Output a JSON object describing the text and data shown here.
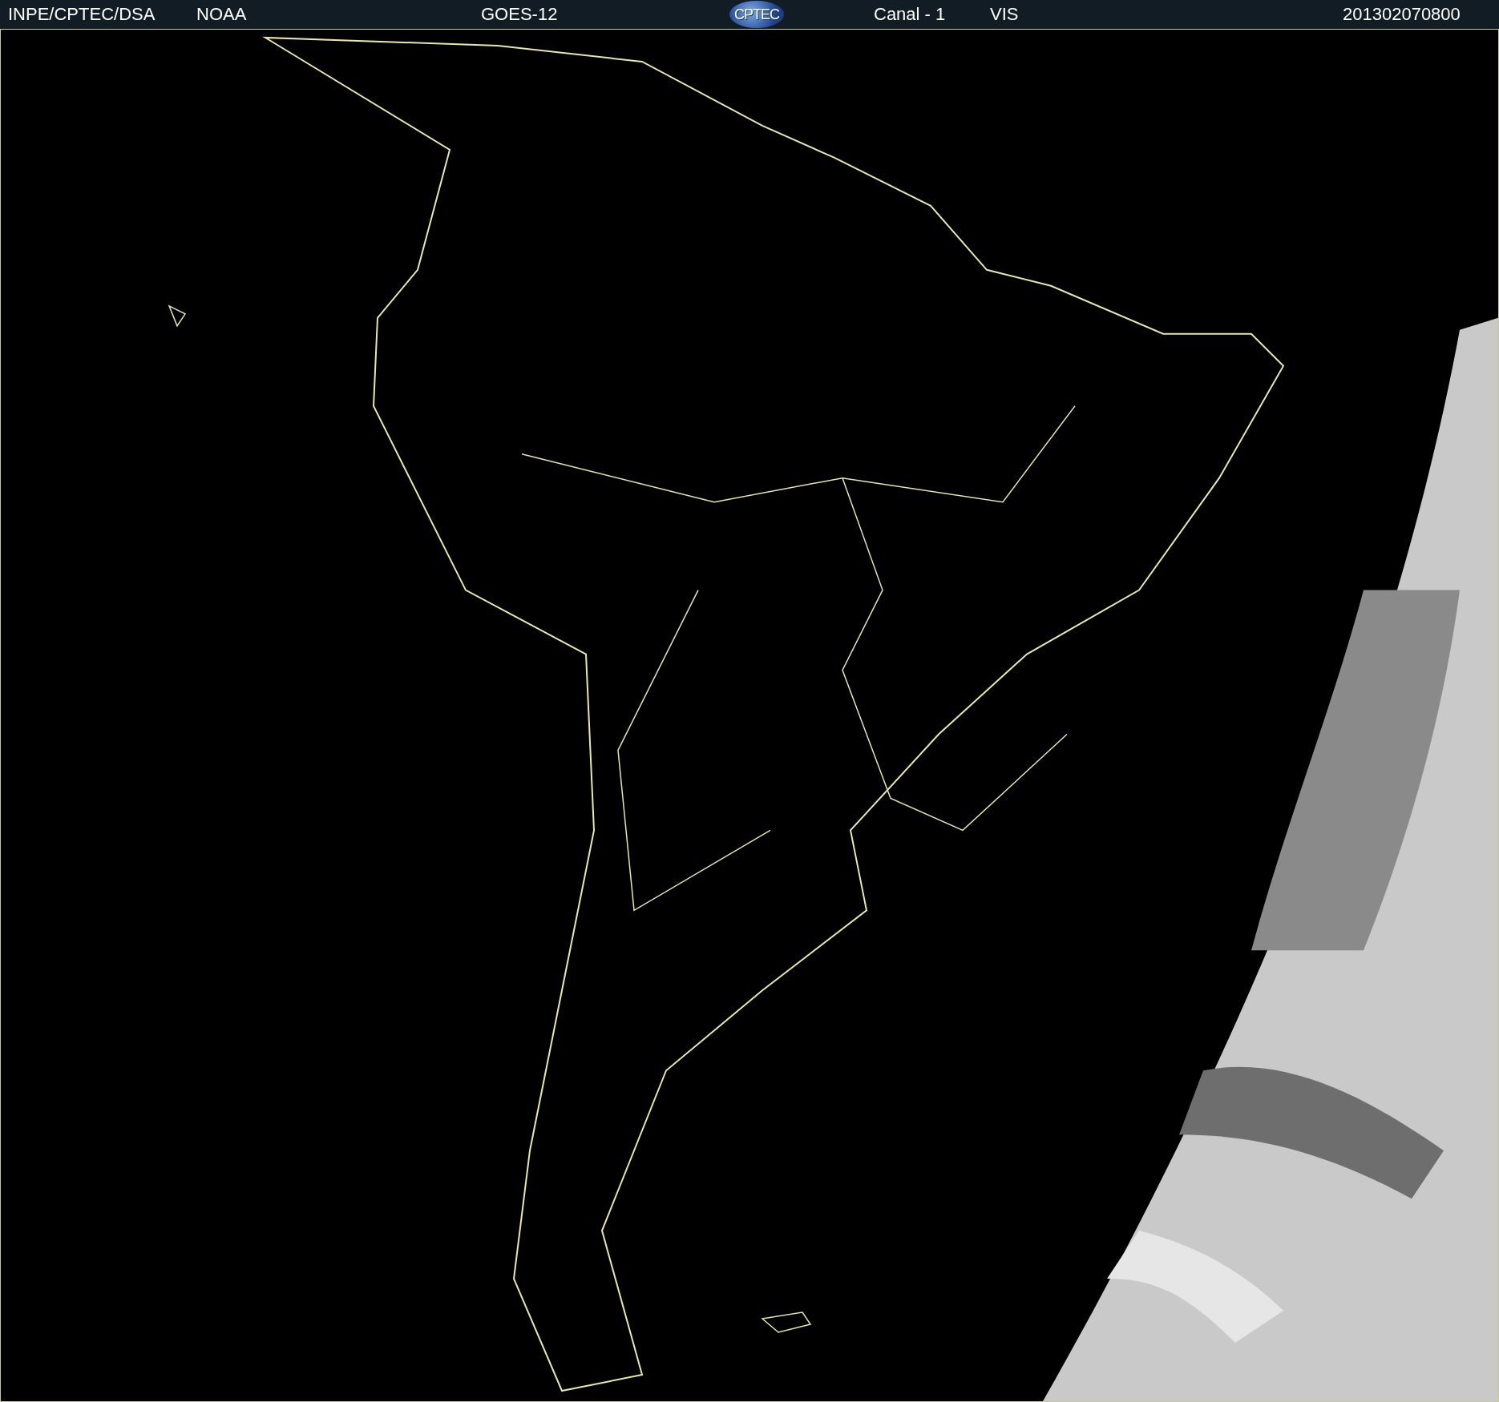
{
  "header": {
    "source": "INPE/CPTEC/DSA",
    "agency": "NOAA",
    "satellite": "GOES-12",
    "logo_text": "CPTEC",
    "channel": "Canal - 1",
    "band": "VIS",
    "timestamp": "201302070800"
  }
}
